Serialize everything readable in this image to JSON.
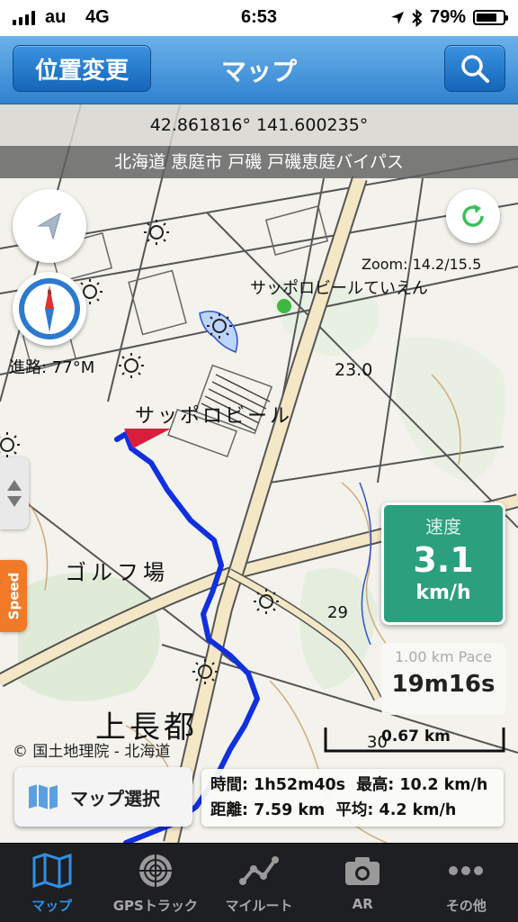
{
  "status_bar": {
    "carrier": "au",
    "network": "4G",
    "time": "6:53",
    "battery_percent": "79%",
    "battery_level": 0.79,
    "icons": [
      "signal-icon",
      "location-arrow-icon",
      "bluetooth-icon",
      "battery-icon"
    ]
  },
  "nav": {
    "location_change_label": "位置変更",
    "title": "マップ",
    "search_icon": "search-icon"
  },
  "map": {
    "coordinates": "42.861816° 141.600235°",
    "address": "北海道 恵庭市 戸磯 戸磯恵庭バイパス",
    "zoom": "Zoom: 14.2/15.5",
    "heading": "進路: 77°M",
    "labels": {
      "garden": "サッポロビールていえん",
      "brewery": "サッポロビール",
      "golf": "ゴルフ場",
      "place": "上長都",
      "elev1": "23.0",
      "elev2": "29",
      "elev3": "30"
    },
    "speed_tab_label": "Speed",
    "speed": {
      "title": "速度",
      "value": "3.1",
      "unit": "km/h"
    },
    "pace": {
      "title": "1.00 km Pace",
      "value": "19m16s"
    },
    "scale": "0.67 km",
    "copyright": "© 国土地理院 - 北海道",
    "map_select_label": "マップ選択",
    "stats": {
      "time": "時間: 1h52m40s",
      "max": "最高: 10.2 km/h",
      "distance": "距離: 7.59 km",
      "avg": "平均: 4.2 km/h"
    },
    "colors": {
      "track": "#1030e0",
      "speed_panel": "#2c9f7e",
      "speed_tab": "#f07a28",
      "accent": "#2f8fe8"
    }
  },
  "tabs": [
    {
      "label": "マップ",
      "icon": "map-icon",
      "active": true
    },
    {
      "label": "GPSトラック",
      "icon": "radar-icon",
      "active": false
    },
    {
      "label": "マイルート",
      "icon": "route-icon",
      "active": false
    },
    {
      "label": "AR",
      "icon": "camera-icon",
      "active": false
    },
    {
      "label": "その他",
      "icon": "more-icon",
      "active": false
    }
  ]
}
